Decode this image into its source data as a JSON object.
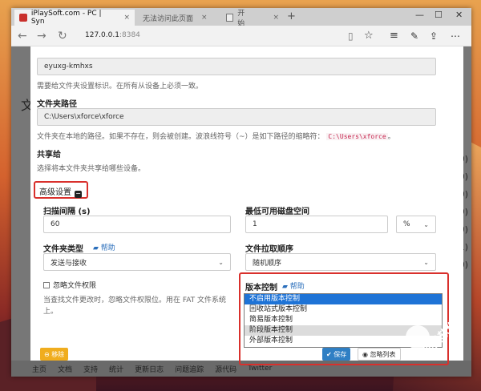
{
  "tabs": [
    {
      "title": "iPlaySoft.com - PC | Syn",
      "close": "×"
    },
    {
      "title": "无法访问此页面",
      "close": "×"
    },
    {
      "title": "开始",
      "close": "×"
    }
  ],
  "new_tab": "+",
  "window_controls": [
    "—",
    "☐",
    "✕"
  ],
  "address": {
    "host": "127.0.0.1",
    "port": ":8384"
  },
  "behind": {
    "title_char": "文",
    "right_digits": [
      "0)",
      "0)",
      "0)",
      "9)",
      "0)",
      "1)",
      "0)"
    ],
    "footer": [
      "主页",
      "文档",
      "支持",
      "统计",
      "更新日志",
      "问题追踪",
      "源代码",
      "Twitter"
    ]
  },
  "form": {
    "folder_id_value": "eyuxg-kmhxs",
    "folder_id_help": "需要给文件夹设置标识。在所有从设备上必须一致。",
    "folder_path_label": "文件夹路径",
    "folder_path_value": "C:\\Users\\xforce\\xforce",
    "folder_path_help_prefix": "文件夹在本地的路径。如果不存在，则会被创建。波浪线符号（~）是如下路径的缩略符：",
    "folder_path_help_code": "C:\\Users\\xforce",
    "folder_path_help_suffix": "。",
    "share_label": "共享给",
    "share_help": "选择将本文件夹共享给哪些设备。",
    "advanced_label": "高级设置",
    "advanced_icon": "−",
    "rescan_label": "扫描间隔 (s)",
    "rescan_value": "60",
    "min_disk_label": "最低可用磁盘空间",
    "min_disk_value": "1",
    "min_disk_unit": "%",
    "folder_type_label": "文件夹类型",
    "help_text": "帮助",
    "folder_type_value": "发送与接收",
    "pull_order_label": "文件拉取顺序",
    "pull_order_value": "随机顺序",
    "ignore_perms_label": "忽略文件权限",
    "ignore_perms_help": "当查找文件更改时，忽略文件权限位。用在 FAT 文件系统上。",
    "versioning_label": "版本控制",
    "versioning_options": [
      "不启用版本控制",
      "回收站式版本控制",
      "简易版本控制",
      "阶段版本控制",
      "外部版本控制"
    ],
    "versioning_selected": 0,
    "versioning_hover": 3
  },
  "buttons": {
    "remove": "移除",
    "save": "保存",
    "ignore": "忽略列表"
  },
  "watermark": "异星软件"
}
